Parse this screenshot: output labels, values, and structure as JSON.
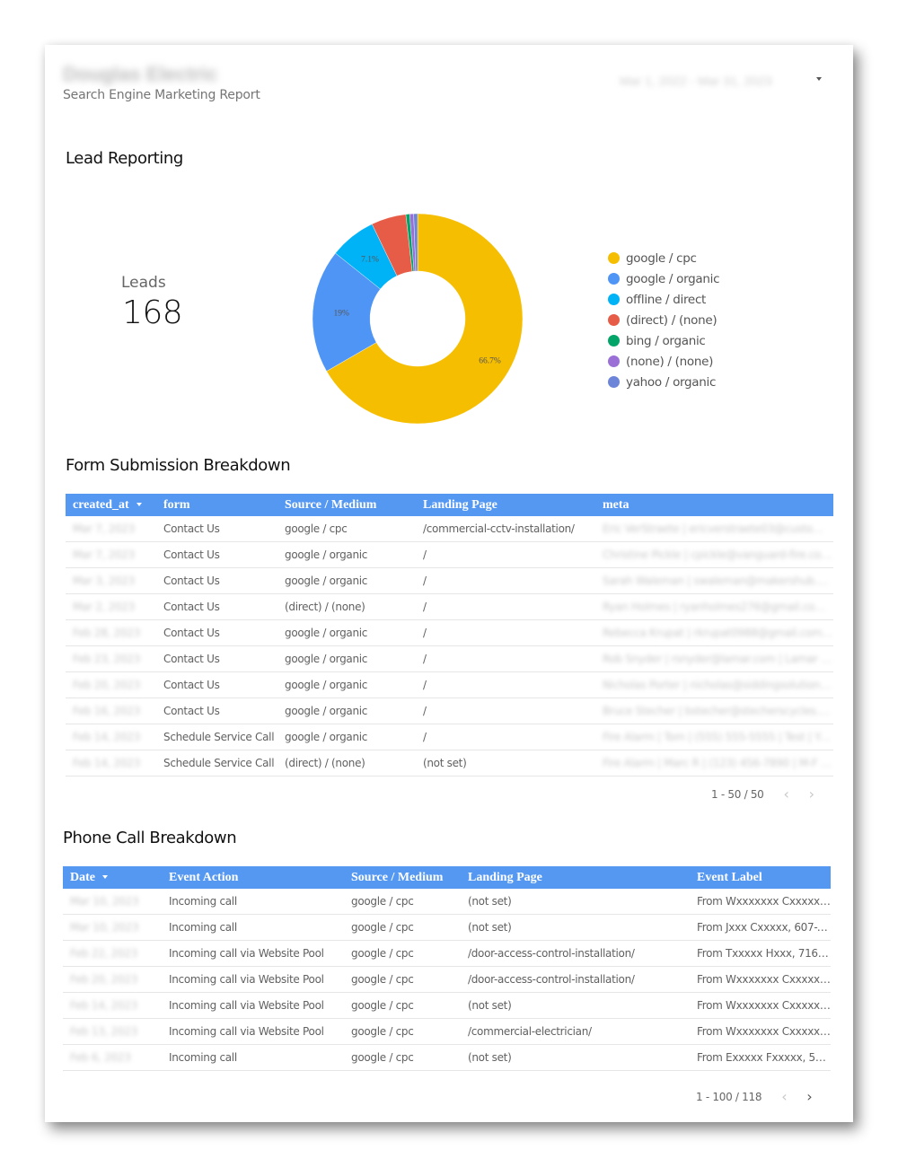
{
  "header": {
    "title": "Douglas Electric",
    "subtitle": "Search Engine Marketing Report",
    "date_range": "Mar 1, 2022 - Mar 31, 2023"
  },
  "lead_reporting": {
    "title": "Lead Reporting",
    "kpi": {
      "label": "Leads",
      "value": "168"
    }
  },
  "chart_data": {
    "type": "pie",
    "variant": "donut",
    "title": "Lead Reporting",
    "total": 168,
    "categories": [
      "google / cpc",
      "google / organic",
      "offline / direct",
      "(direct) / (none)",
      "bing / organic",
      "(none) / (none)",
      "yahoo / organic"
    ],
    "values": [
      112,
      32,
      12,
      9,
      1,
      1,
      1
    ],
    "percent_labels": [
      "66.7%",
      "19%",
      "7.1%",
      "",
      "",
      "",
      ""
    ],
    "colors": [
      "#f6be00",
      "#4f95f5",
      "#00b2f6",
      "#e65c47",
      "#02a567",
      "#9a6fd6",
      "#6c85d8"
    ],
    "legend_position": "right"
  },
  "form_submissions": {
    "title": "Form Submission Breakdown",
    "columns": [
      "created_at",
      "form",
      "Source / Medium",
      "Landing Page",
      "meta"
    ],
    "sort_column": "created_at",
    "rows": [
      [
        "Mar 7, 2023",
        "Contact Us",
        "google / cpc",
        "/commercial-cctv-installation/",
        "Eric VerStraete | ericverstraete03@customer.com | ..."
      ],
      [
        "Mar 7, 2023",
        "Contact Us",
        "google / organic",
        "/",
        "Christine Pickle | cpickle@vanguard-fire.com | ..."
      ],
      [
        "Mar 3, 2023",
        "Contact Us",
        "google / organic",
        "/",
        "Sarah Waleman | swaleman@makershub.ai | ..."
      ],
      [
        "Mar 2, 2023",
        "Contact Us",
        "(direct) / (none)",
        "/",
        "Ryan Holmes | ryanholmes276@gmail.com | | ..."
      ],
      [
        "Feb 28, 2023",
        "Contact Us",
        "google / organic",
        "/",
        "Rebecca Krupat | rkrupat0988@gmail.com | Ful..."
      ],
      [
        "Feb 23, 2023",
        "Contact Us",
        "google / organic",
        "/",
        "Rob Snyder | rsnyder@lamar.com | Lamar Adv..."
      ],
      [
        "Feb 20, 2023",
        "Contact Us",
        "google / organic",
        "/",
        "Nicholas Porter | nicholas@siddingsolutionsllc..."
      ],
      [
        "Feb 16, 2023",
        "Contact Us",
        "google / organic",
        "/",
        "Bruce Stecher | bstecher@stecherscycles.com ..."
      ],
      [
        "Feb 14, 2023",
        "Schedule Service Call",
        "google / organic",
        "/",
        "Fire Alarm | Tom | (555) 555-5555 | Test | Yes | ..."
      ],
      [
        "Feb 14, 2023",
        "Schedule Service Call",
        "(direct) / (none)",
        "(not set)",
        "Fire Alarm | Marc R | (123) 456-7890 | M-F 8 - ..."
      ]
    ],
    "pagination": "1 - 50 / 50"
  },
  "phone_calls": {
    "title": "Phone Call Breakdown",
    "columns": [
      "Date",
      "Event Action",
      "Source / Medium",
      "Landing Page",
      "Event Label"
    ],
    "sort_column": "Date",
    "rows": [
      [
        "Mar 10, 2023",
        "Incoming call",
        "google / cpc",
        "(not set)",
        "From Wxxxxxxx Cxxxxx, ..."
      ],
      [
        "Mar 10, 2023",
        "Incoming call",
        "google / cpc",
        "(not set)",
        "From Jxxx Cxxxxx, 607-X..."
      ],
      [
        "Feb 22, 2023",
        "Incoming call via Website Pool",
        "google / cpc",
        "/door-access-control-installation/",
        "From Txxxxx Hxxx, 716-..."
      ],
      [
        "Feb 20, 2023",
        "Incoming call via Website Pool",
        "google / cpc",
        "/door-access-control-installation/",
        "From Wxxxxxxx Cxxxxx, ..."
      ],
      [
        "Feb 14, 2023",
        "Incoming call via Website Pool",
        "google / cpc",
        "(not set)",
        "From Wxxxxxxx Cxxxxx, ..."
      ],
      [
        "Feb 13, 2023",
        "Incoming call via Website Pool",
        "google / cpc",
        "/commercial-electrician/",
        "From Wxxxxxxx Cxxxxx, ..."
      ],
      [
        "Feb 6, 2023",
        "Incoming call",
        "google / cpc",
        "(not set)",
        "From Exxxxx Fxxxxx, 58..."
      ]
    ],
    "pagination": "1 - 100 / 118"
  },
  "icons": {
    "sort_desc": "caret-down-icon",
    "prev_page": "chevron-left-icon",
    "next_page": "chevron-right-icon",
    "date_dropdown": "caret-down-icon"
  }
}
